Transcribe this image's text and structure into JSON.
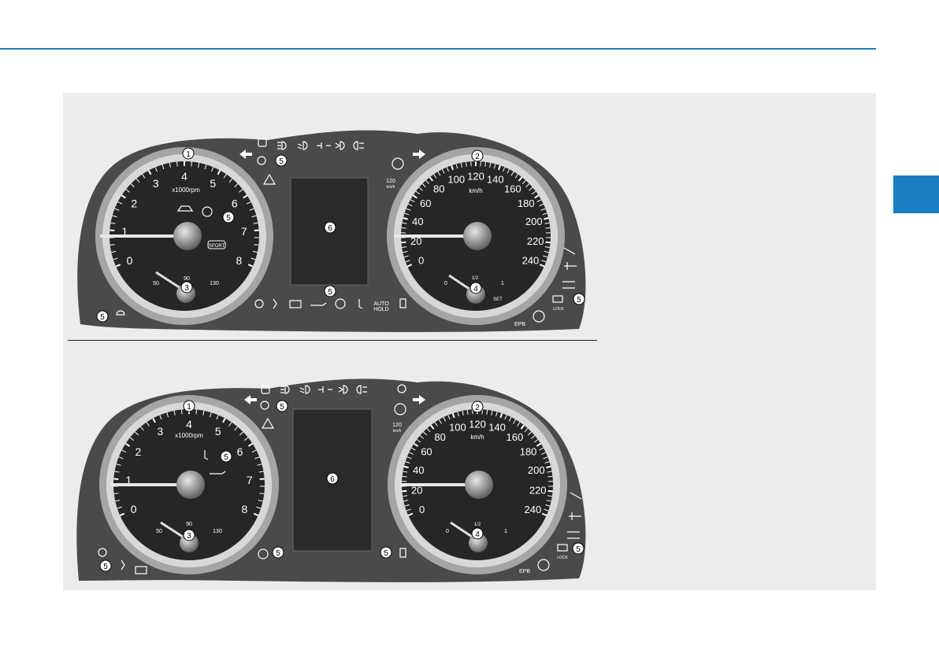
{
  "page": {
    "accent_color": "#1a7fc2",
    "panel_bg": "#ececec",
    "cluster_bg": "#4a4a4a"
  },
  "clusters": [
    {
      "tach": {
        "ticks": [
          "0",
          "1",
          "2",
          "3",
          "4",
          "5",
          "6",
          "7",
          "8"
        ],
        "unit": "x1000rpm",
        "temp_low": "50",
        "temp_mid": "90",
        "temp_high": "130",
        "mode_badge": "SPORT"
      },
      "speedo": {
        "ticks": [
          "0",
          "20",
          "40",
          "60",
          "80",
          "100",
          "120",
          "140",
          "160",
          "180",
          "200",
          "220",
          "240"
        ],
        "unit": "km/h",
        "limit_label": "120",
        "limit_unit": "km/h",
        "fuel_empty": "0",
        "fuel_half": "1/2",
        "fuel_full": "1",
        "set_label": "SET"
      },
      "indicator_labels": {
        "auto_hold_1": "AUTO",
        "auto_hold_2": "HOLD",
        "epb": "EPB",
        "lock": "LOCK"
      },
      "callouts": {
        "tach": "1",
        "speedo": "2",
        "temp": "3",
        "fuel": "4",
        "warning": "5",
        "lcd": "6"
      }
    },
    {
      "tach": {
        "ticks": [
          "0",
          "1",
          "2",
          "3",
          "4",
          "5",
          "6",
          "7",
          "8"
        ],
        "unit": "x1000rpm",
        "temp_low": "50",
        "temp_mid": "90",
        "temp_high": "130"
      },
      "speedo": {
        "ticks": [
          "0",
          "20",
          "40",
          "60",
          "80",
          "100",
          "120",
          "140",
          "160",
          "180",
          "200",
          "220",
          "240"
        ],
        "unit": "km/h",
        "limit_label": "120",
        "limit_unit": "km/h",
        "fuel_empty": "0",
        "fuel_half": "1/2",
        "fuel_full": "1"
      },
      "indicator_labels": {
        "epb": "EPB",
        "lock": "LOCK"
      },
      "callouts": {
        "tach": "1",
        "speedo": "2",
        "temp": "3",
        "fuel": "4",
        "warning": "5",
        "lcd": "6"
      }
    }
  ]
}
